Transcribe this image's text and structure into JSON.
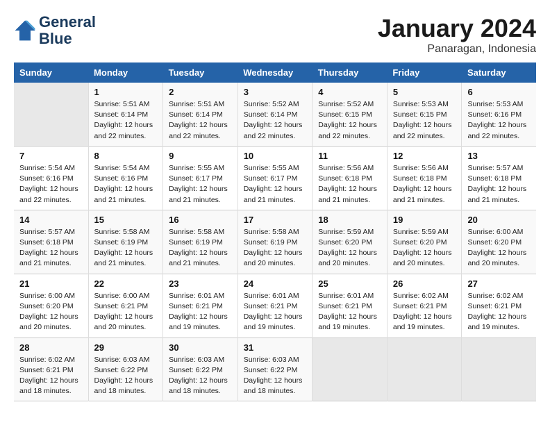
{
  "logo": {
    "line1": "General",
    "line2": "Blue"
  },
  "title": "January 2024",
  "subtitle": "Panaragan, Indonesia",
  "days_of_week": [
    "Sunday",
    "Monday",
    "Tuesday",
    "Wednesday",
    "Thursday",
    "Friday",
    "Saturday"
  ],
  "weeks": [
    [
      {
        "day": "",
        "sunrise": "",
        "sunset": "",
        "daylight": ""
      },
      {
        "day": "1",
        "sunrise": "Sunrise: 5:51 AM",
        "sunset": "Sunset: 6:14 PM",
        "daylight": "Daylight: 12 hours and 22 minutes."
      },
      {
        "day": "2",
        "sunrise": "Sunrise: 5:51 AM",
        "sunset": "Sunset: 6:14 PM",
        "daylight": "Daylight: 12 hours and 22 minutes."
      },
      {
        "day": "3",
        "sunrise": "Sunrise: 5:52 AM",
        "sunset": "Sunset: 6:14 PM",
        "daylight": "Daylight: 12 hours and 22 minutes."
      },
      {
        "day": "4",
        "sunrise": "Sunrise: 5:52 AM",
        "sunset": "Sunset: 6:15 PM",
        "daylight": "Daylight: 12 hours and 22 minutes."
      },
      {
        "day": "5",
        "sunrise": "Sunrise: 5:53 AM",
        "sunset": "Sunset: 6:15 PM",
        "daylight": "Daylight: 12 hours and 22 minutes."
      },
      {
        "day": "6",
        "sunrise": "Sunrise: 5:53 AM",
        "sunset": "Sunset: 6:16 PM",
        "daylight": "Daylight: 12 hours and 22 minutes."
      }
    ],
    [
      {
        "day": "7",
        "sunrise": "Sunrise: 5:54 AM",
        "sunset": "Sunset: 6:16 PM",
        "daylight": "Daylight: 12 hours and 22 minutes."
      },
      {
        "day": "8",
        "sunrise": "Sunrise: 5:54 AM",
        "sunset": "Sunset: 6:16 PM",
        "daylight": "Daylight: 12 hours and 21 minutes."
      },
      {
        "day": "9",
        "sunrise": "Sunrise: 5:55 AM",
        "sunset": "Sunset: 6:17 PM",
        "daylight": "Daylight: 12 hours and 21 minutes."
      },
      {
        "day": "10",
        "sunrise": "Sunrise: 5:55 AM",
        "sunset": "Sunset: 6:17 PM",
        "daylight": "Daylight: 12 hours and 21 minutes."
      },
      {
        "day": "11",
        "sunrise": "Sunrise: 5:56 AM",
        "sunset": "Sunset: 6:18 PM",
        "daylight": "Daylight: 12 hours and 21 minutes."
      },
      {
        "day": "12",
        "sunrise": "Sunrise: 5:56 AM",
        "sunset": "Sunset: 6:18 PM",
        "daylight": "Daylight: 12 hours and 21 minutes."
      },
      {
        "day": "13",
        "sunrise": "Sunrise: 5:57 AM",
        "sunset": "Sunset: 6:18 PM",
        "daylight": "Daylight: 12 hours and 21 minutes."
      }
    ],
    [
      {
        "day": "14",
        "sunrise": "Sunrise: 5:57 AM",
        "sunset": "Sunset: 6:18 PM",
        "daylight": "Daylight: 12 hours and 21 minutes."
      },
      {
        "day": "15",
        "sunrise": "Sunrise: 5:58 AM",
        "sunset": "Sunset: 6:19 PM",
        "daylight": "Daylight: 12 hours and 21 minutes."
      },
      {
        "day": "16",
        "sunrise": "Sunrise: 5:58 AM",
        "sunset": "Sunset: 6:19 PM",
        "daylight": "Daylight: 12 hours and 21 minutes."
      },
      {
        "day": "17",
        "sunrise": "Sunrise: 5:58 AM",
        "sunset": "Sunset: 6:19 PM",
        "daylight": "Daylight: 12 hours and 20 minutes."
      },
      {
        "day": "18",
        "sunrise": "Sunrise: 5:59 AM",
        "sunset": "Sunset: 6:20 PM",
        "daylight": "Daylight: 12 hours and 20 minutes."
      },
      {
        "day": "19",
        "sunrise": "Sunrise: 5:59 AM",
        "sunset": "Sunset: 6:20 PM",
        "daylight": "Daylight: 12 hours and 20 minutes."
      },
      {
        "day": "20",
        "sunrise": "Sunrise: 6:00 AM",
        "sunset": "Sunset: 6:20 PM",
        "daylight": "Daylight: 12 hours and 20 minutes."
      }
    ],
    [
      {
        "day": "21",
        "sunrise": "Sunrise: 6:00 AM",
        "sunset": "Sunset: 6:20 PM",
        "daylight": "Daylight: 12 hours and 20 minutes."
      },
      {
        "day": "22",
        "sunrise": "Sunrise: 6:00 AM",
        "sunset": "Sunset: 6:21 PM",
        "daylight": "Daylight: 12 hours and 20 minutes."
      },
      {
        "day": "23",
        "sunrise": "Sunrise: 6:01 AM",
        "sunset": "Sunset: 6:21 PM",
        "daylight": "Daylight: 12 hours and 19 minutes."
      },
      {
        "day": "24",
        "sunrise": "Sunrise: 6:01 AM",
        "sunset": "Sunset: 6:21 PM",
        "daylight": "Daylight: 12 hours and 19 minutes."
      },
      {
        "day": "25",
        "sunrise": "Sunrise: 6:01 AM",
        "sunset": "Sunset: 6:21 PM",
        "daylight": "Daylight: 12 hours and 19 minutes."
      },
      {
        "day": "26",
        "sunrise": "Sunrise: 6:02 AM",
        "sunset": "Sunset: 6:21 PM",
        "daylight": "Daylight: 12 hours and 19 minutes."
      },
      {
        "day": "27",
        "sunrise": "Sunrise: 6:02 AM",
        "sunset": "Sunset: 6:21 PM",
        "daylight": "Daylight: 12 hours and 19 minutes."
      }
    ],
    [
      {
        "day": "28",
        "sunrise": "Sunrise: 6:02 AM",
        "sunset": "Sunset: 6:21 PM",
        "daylight": "Daylight: 12 hours and 18 minutes."
      },
      {
        "day": "29",
        "sunrise": "Sunrise: 6:03 AM",
        "sunset": "Sunset: 6:22 PM",
        "daylight": "Daylight: 12 hours and 18 minutes."
      },
      {
        "day": "30",
        "sunrise": "Sunrise: 6:03 AM",
        "sunset": "Sunset: 6:22 PM",
        "daylight": "Daylight: 12 hours and 18 minutes."
      },
      {
        "day": "31",
        "sunrise": "Sunrise: 6:03 AM",
        "sunset": "Sunset: 6:22 PM",
        "daylight": "Daylight: 12 hours and 18 minutes."
      },
      {
        "day": "",
        "sunrise": "",
        "sunset": "",
        "daylight": ""
      },
      {
        "day": "",
        "sunrise": "",
        "sunset": "",
        "daylight": ""
      },
      {
        "day": "",
        "sunrise": "",
        "sunset": "",
        "daylight": ""
      }
    ]
  ]
}
